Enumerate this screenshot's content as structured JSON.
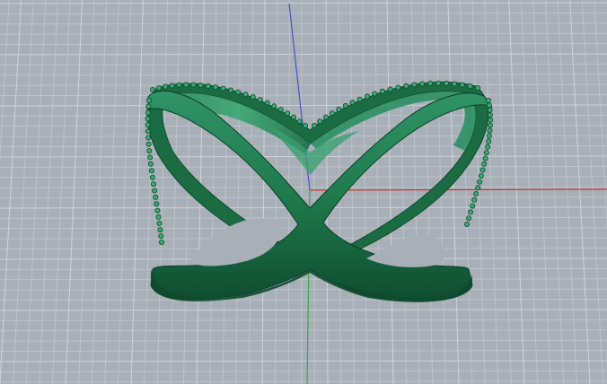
{
  "viewport": {
    "view": "perspective",
    "background_color": "#a8afb7",
    "grid": {
      "visible": true,
      "minor_line_color": "#bcc2c9",
      "major_line_color": "#cdd2d8"
    },
    "axes": {
      "x_color": "#c83a3a",
      "y_color": "#3aa64a",
      "z_color": "#5050c8"
    }
  },
  "model": {
    "name": "crossover-ring",
    "body_color": "#1f7a4c",
    "highlight_color": "#3aa872",
    "shadow_color": "#0e4a2c",
    "pave_stones": true
  }
}
